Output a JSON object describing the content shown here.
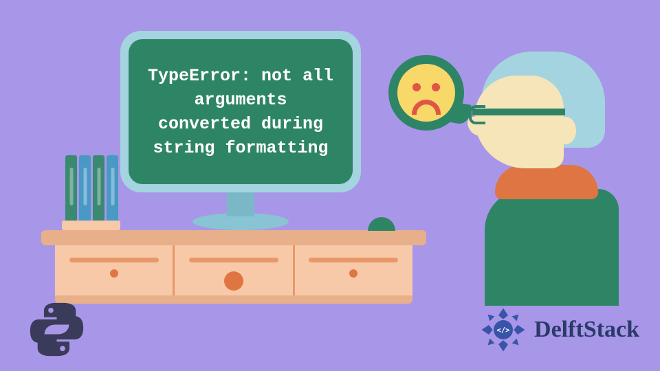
{
  "error_message": "TypeError: not all arguments converted during string formatting",
  "brand": {
    "name": "DelftStack"
  },
  "colors": {
    "background": "#a896e8",
    "screen": "#2e8566",
    "accent_orange": "#e07544",
    "accent_yellow": "#f8d868",
    "desk": "#f8c9a8",
    "monitor_bezel": "#a4d4e0"
  },
  "icons": {
    "emoji": "sad-face",
    "language": "python"
  }
}
